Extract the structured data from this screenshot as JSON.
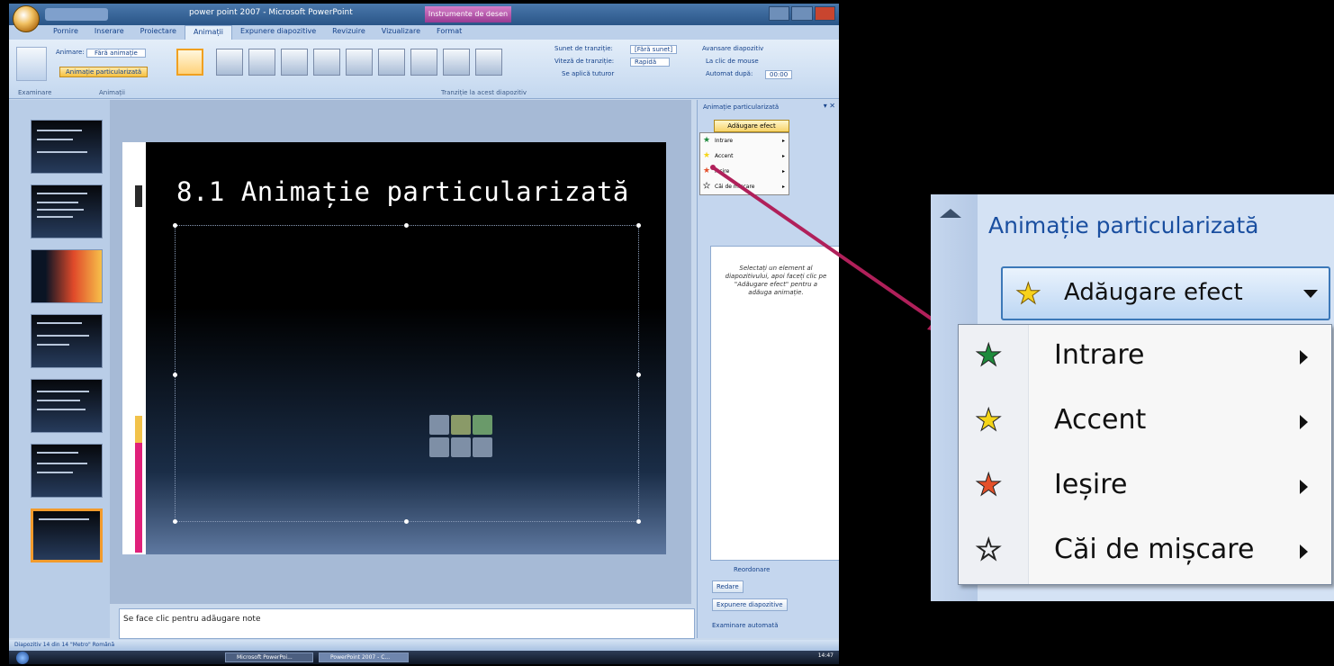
{
  "window": {
    "title": "power point 2007 - Microsoft PowerPoint",
    "contextual_tag": "Instrumente de desen"
  },
  "ribbon": {
    "tabs": [
      "Pornire",
      "Inserare",
      "Proiectare",
      "Animații",
      "Expunere diapozitive",
      "Revizuire",
      "Vizualizare",
      "Format"
    ],
    "active_tab": "Animații",
    "animate_label": "Animare:",
    "animate_value": "Fără animație",
    "custom_animation_label": "Animație particularizată",
    "sound_label": "Sunet de tranziție:",
    "sound_value": "[Fără sunet]",
    "speed_label": "Viteză de tranziție:",
    "speed_value": "Rapidă",
    "apply_all_label": "Se aplică tuturor",
    "advance_label": "Avansare diapozitiv",
    "on_click_label": "La clic de mouse",
    "auto_after_label": "Automat după:",
    "auto_after_value": "00:00",
    "group_labels": [
      "Examinare",
      "Animații",
      "Tranziție la acest diapozitiv"
    ]
  },
  "slide": {
    "title": "8.1 Animație particularizată"
  },
  "notes": {
    "placeholder": "Se face clic pentru adăugare note"
  },
  "task_pane": {
    "title": "Animație particularizată",
    "add_effect_label": "Adăugare efect",
    "menu": [
      "Intrare",
      "Accent",
      "Ieșire",
      "Căi de mișcare"
    ],
    "description": "Selectați un element al diapozitivului, apoi faceți clic pe \"Adăugare efect\" pentru a adăuga animație.",
    "reorder_label": "Reordonare",
    "play_label": "Redare",
    "slideshow_label": "Expunere diapozitive",
    "autopreview_label": "Examinare automată"
  },
  "status_bar": {
    "text": "Diapozitiv 14 din 14   \"Metro\"   Română"
  },
  "taskbar": {
    "items": [
      "Microsoft PowerPoi...",
      "PowerPoint 2007 - C..."
    ],
    "clock": "14:47"
  },
  "zoom": {
    "title": "Animație particularizată",
    "add_effect_label": "Adăugare efect",
    "menu": [
      {
        "label": "Intrare",
        "icon": "entrance-star-icon",
        "color": "#1e8a3c"
      },
      {
        "label": "Accent",
        "icon": "emphasis-star-icon",
        "color": "#f5d518"
      },
      {
        "label": "Ieșire",
        "icon": "exit-star-icon",
        "color": "#e4502a"
      },
      {
        "label": "Căi de mișcare",
        "icon": "motion-path-star-icon",
        "color": "#ffffff"
      }
    ]
  },
  "colors": {
    "arrow": "#b0205a",
    "accent_orange": "#f29b2c",
    "ribbon_text": "#15428b"
  }
}
